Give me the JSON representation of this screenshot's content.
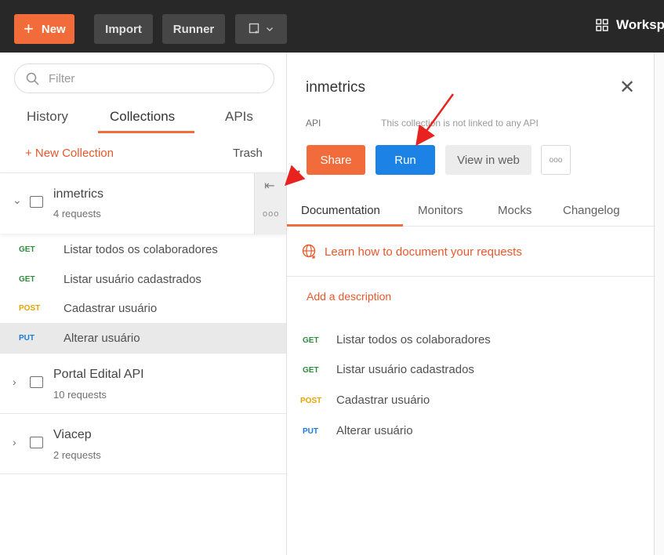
{
  "topbar": {
    "new_label": "New",
    "import_label": "Import",
    "runner_label": "Runner",
    "workspace_label": "Worksp"
  },
  "sidebar": {
    "filter_placeholder": "Filter",
    "tabs": [
      "History",
      "Collections",
      "APIs"
    ],
    "new_collection_label": "+ New Collection",
    "trash_label": "Trash",
    "collections": [
      {
        "name": "inmetrics",
        "count": "4 requests",
        "requests": [
          {
            "method": "GET",
            "name": "Listar todos os colaboradores"
          },
          {
            "method": "GET",
            "name": "Listar usuário cadastrados"
          },
          {
            "method": "POST",
            "name": "Cadastrar usuário"
          },
          {
            "method": "PUT",
            "name": "Alterar usuário"
          }
        ]
      },
      {
        "name": "Portal Edital API",
        "count": "10 requests"
      },
      {
        "name": "Viacep",
        "count": "2 requests"
      }
    ]
  },
  "panel": {
    "title": "inmetrics",
    "api_label": "API",
    "not_linked": "This collection is not linked to any API",
    "share_label": "Share",
    "run_label": "Run",
    "view_web_label": "View in web",
    "more_label": "ooo",
    "tabs": [
      "Documentation",
      "Monitors",
      "Mocks",
      "Changelog"
    ],
    "learn_link": "Learn how to document your requests",
    "add_description": "Add a description",
    "requests": [
      {
        "method": "GET",
        "name": "Listar todos os colaboradores"
      },
      {
        "method": "GET",
        "name": "Listar usuário cadastrados"
      },
      {
        "method": "POST",
        "name": "Cadastrar usuário"
      },
      {
        "method": "PUT",
        "name": "Alterar usuário"
      }
    ]
  },
  "colors": {
    "accent_orange": "#f26b3a",
    "run_blue": "#1d82e6",
    "get_green": "#2f8a3d",
    "post_yellow": "#e8a400",
    "put_blue": "#1a7ad6",
    "topbar_bg": "#282828"
  }
}
